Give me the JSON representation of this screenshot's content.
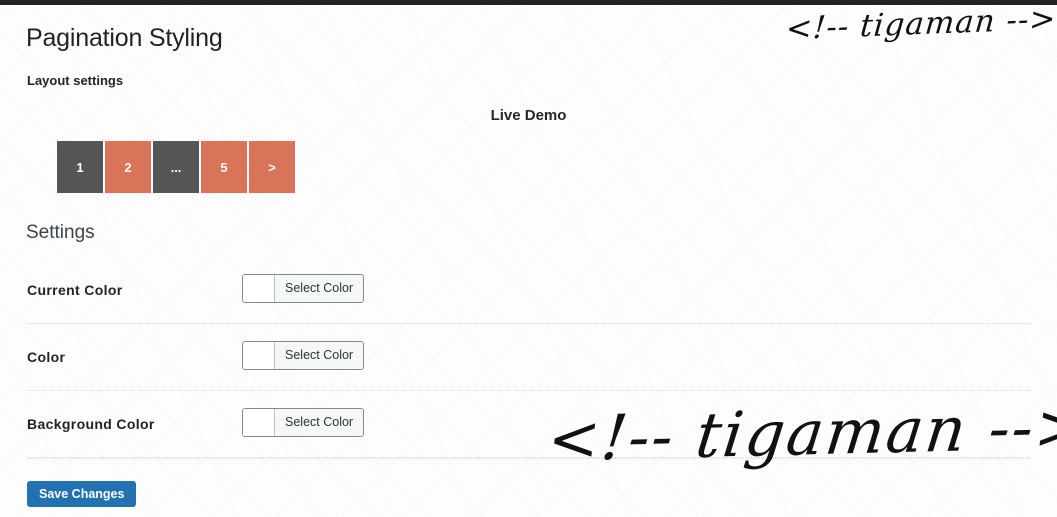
{
  "window": {
    "title": "Pagination Styling"
  },
  "header": {
    "title": "Pagination Styling",
    "subtitle": "Layout settings"
  },
  "demo": {
    "title": "Live Demo",
    "pagination": {
      "items": [
        {
          "label": "1",
          "state": "current",
          "bg": "#555555",
          "fg": "#ffffff"
        },
        {
          "label": "2",
          "state": "normal",
          "bg": "#d9735a",
          "fg": "#ffffff"
        },
        {
          "label": "...",
          "state": "ellipsis",
          "bg": "#555555",
          "fg": "#ffffff"
        },
        {
          "label": "5",
          "state": "normal",
          "bg": "#d9735a",
          "fg": "#ffffff"
        },
        {
          "label": ">",
          "state": "next",
          "bg": "#d9735a",
          "fg": "#ffffff"
        }
      ]
    }
  },
  "settings": {
    "title": "Settings",
    "rows": [
      {
        "label": "Current Color",
        "button_label": "Select Color",
        "swatch_color": "#ffffff"
      },
      {
        "label": "Color",
        "button_label": "Select Color",
        "swatch_color": "#ffffff"
      },
      {
        "label": "Background Color",
        "button_label": "Select Color",
        "swatch_color": "#ffffff"
      }
    ]
  },
  "submit": {
    "save_label": "Save Changes",
    "accent_color": "#2271b1"
  },
  "watermarks": {
    "top": "<!-- tigaman -->",
    "main": "<!-- tigaman -->"
  }
}
